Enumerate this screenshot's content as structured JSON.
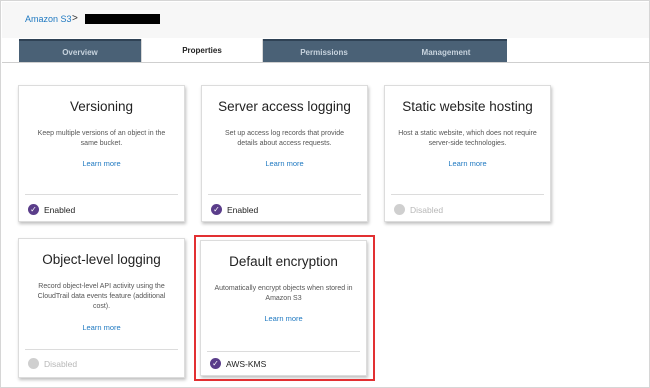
{
  "breadcrumb": {
    "root": "Amazon S3",
    "separator": ">"
  },
  "tabs": [
    {
      "label": "Overview"
    },
    {
      "label": "Properties"
    },
    {
      "label": "Permissions"
    },
    {
      "label": "Management"
    }
  ],
  "active_tab": "Properties",
  "cards": [
    {
      "title": "Versioning",
      "description": "Keep multiple versions of an object in the same bucket.",
      "learn_more": "Learn more",
      "status": "Enabled",
      "status_icon": "check-circle-icon"
    },
    {
      "title": "Server access logging",
      "description": "Set up access log records that provide details about access requests.",
      "learn_more": "Learn more",
      "status": "Enabled",
      "status_icon": "check-circle-icon"
    },
    {
      "title": "Static website hosting",
      "description": "Host a static website, which does not require server-side technologies.",
      "learn_more": "Learn more",
      "status": "Disabled",
      "status_icon": "disabled-circle-icon"
    },
    {
      "title": "Object-level logging",
      "description": "Record object-level API activity using the CloudTrail data events feature (additional cost).",
      "learn_more": "Learn more",
      "status": "Disabled",
      "status_icon": "disabled-circle-icon"
    },
    {
      "title": "Default encryption",
      "description": "Automatically encrypt objects when stored in Amazon S3",
      "learn_more": "Learn more",
      "status": "AWS-KMS",
      "status_icon": "check-circle-icon"
    }
  ],
  "colors": {
    "tab_inactive": "#4a6176",
    "link": "#1f79c1",
    "enabled_dot": "#5a3d8a",
    "disabled_dot": "#cfcfcf",
    "highlight": "#e23032"
  }
}
